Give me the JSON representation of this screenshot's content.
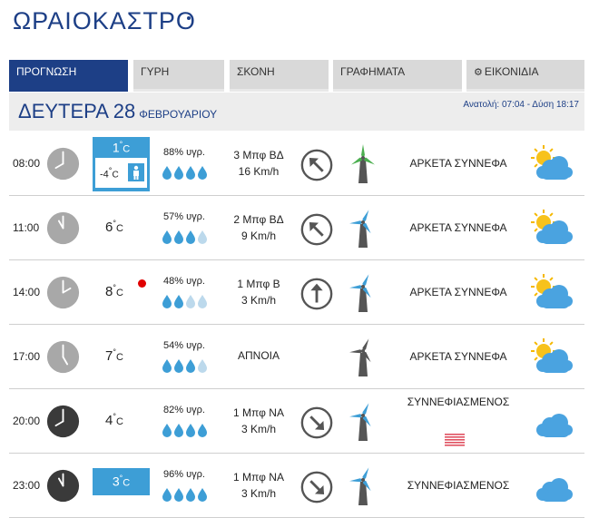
{
  "city": {
    "name": "ΩΡΑΙΟΚΑΣΤΡΟ"
  },
  "tabs": [
    {
      "label": "ΠΡΟΓΝΩΣΗ",
      "active": true
    },
    {
      "label": "ΓΥΡΗ",
      "active": false
    },
    {
      "label": "ΣΚΟΝΗ",
      "active": false
    },
    {
      "label": "ΓΡΑΦΗΜΑΤΑ",
      "active": false
    },
    {
      "label": "ΕΙΚΟΝΙΔΙΑ",
      "active": false,
      "icon": "gear-icon"
    }
  ],
  "day": {
    "title": "ΔΕΥΤΕΡΑ 28",
    "month": "ΦΕΒΡΟΥΑΡΙΟΥ",
    "sun": "Ανατολή: 07:04 - Δύση 18:17"
  },
  "colors": {
    "brand_blue": "#1d3f86",
    "temp_box_blue": "#3d9ed6",
    "drop_blue": "#3d9ed6",
    "drop_light": "#bcd9ec",
    "clock_day": "#a8a8a8",
    "clock_night": "#3a3a3a",
    "turbine_blade_blue": "#3d9ed6",
    "turbine_blade_green": "#4caf50",
    "rain_red": "#e05060"
  },
  "forecast": [
    {
      "time": "08:00",
      "hour": 8,
      "clock": "day",
      "temp": "1",
      "feels": "-4",
      "temp_style": "box-feel",
      "humidity": "88% υγρ.",
      "drops": 4,
      "wind_line1": "3 Μπφ ΒΔ",
      "wind_line2": "16 Km/h",
      "wind_arrow_deg": 135,
      "turbine": "green",
      "condition": "ΑΡΚΕΤΑ ΣΥΝΝΕΦΑ",
      "weather_icon": "sun-cloud-icon",
      "alert": false
    },
    {
      "time": "11:00",
      "hour": 11,
      "clock": "day",
      "temp": "6",
      "temp_style": "plain",
      "humidity": "57% υγρ.",
      "drops": 3,
      "wind_line1": "2 Μπφ ΒΔ",
      "wind_line2": "9 Km/h",
      "wind_arrow_deg": 135,
      "turbine": "blue",
      "condition": "ΑΡΚΕΤΑ ΣΥΝΝΕΦΑ",
      "weather_icon": "sun-cloud-icon",
      "alert": false
    },
    {
      "time": "14:00",
      "hour": 14,
      "clock": "day",
      "temp": "8",
      "temp_style": "plain",
      "humidity": "48% υγρ.",
      "drops": 2,
      "wind_line1": "1 Μπφ Β",
      "wind_line2": "3 Km/h",
      "wind_arrow_deg": 180,
      "turbine": "blue",
      "condition": "ΑΡΚΕΤΑ ΣΥΝΝΕΦΑ",
      "weather_icon": "sun-cloud-icon",
      "alert": true
    },
    {
      "time": "17:00",
      "hour": 17,
      "clock": "day",
      "temp": "7",
      "temp_style": "plain",
      "humidity": "54% υγρ.",
      "drops": 3,
      "wind_calm": "ΑΠΝΟΙΑ",
      "turbine": "dark",
      "condition": "ΑΡΚΕΤΑ ΣΥΝΝΕΦΑ",
      "weather_icon": "sun-cloud-icon",
      "alert": false
    },
    {
      "time": "20:00",
      "hour": 20,
      "clock": "night",
      "temp": "4",
      "temp_style": "plain",
      "humidity": "82% υγρ.",
      "drops": 4,
      "wind_line1": "1 Μπφ ΝΑ",
      "wind_line2": "3 Km/h",
      "wind_arrow_deg": -45,
      "turbine": "blue",
      "condition": "ΣΥΝΝΕΦΙΑΣΜΕΝΟΣ",
      "condition_top": true,
      "rain_icon": true,
      "weather_icon": "cloud-icon",
      "alert": false
    },
    {
      "time": "23:00",
      "hour": 23,
      "clock": "night",
      "temp": "3",
      "temp_style": "box",
      "humidity": "96% υγρ.",
      "drops": 4,
      "wind_line1": "1 Μπφ ΝΑ",
      "wind_line2": "3 Km/h",
      "wind_arrow_deg": -45,
      "turbine": "blue",
      "condition": "ΣΥΝΝΕΦΙΑΣΜΕΝΟΣ",
      "weather_icon": "cloud-icon",
      "alert": false
    }
  ]
}
